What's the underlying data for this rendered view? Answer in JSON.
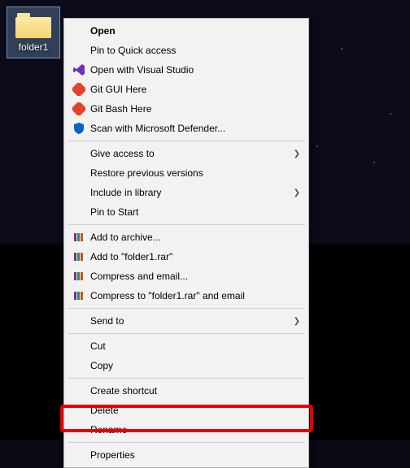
{
  "desktop": {
    "icon_label": "folder1"
  },
  "menu": {
    "open": "Open",
    "pin_quick_access": "Pin to Quick access",
    "open_vs": "Open with Visual Studio",
    "git_gui": "Git GUI Here",
    "git_bash": "Git Bash Here",
    "scan_defender": "Scan with Microsoft Defender...",
    "give_access": "Give access to",
    "restore_prev": "Restore previous versions",
    "include_library": "Include in library",
    "pin_start": "Pin to Start",
    "add_archive": "Add to archive...",
    "add_rar": "Add to \"folder1.rar\"",
    "compress_email": "Compress and email...",
    "compress_rar_email": "Compress to \"folder1.rar\" and email",
    "send_to": "Send to",
    "cut": "Cut",
    "copy": "Copy",
    "create_shortcut": "Create shortcut",
    "delete": "Delete",
    "rename": "Rename",
    "properties": "Properties"
  },
  "icons": {
    "vs": "visual-studio-icon",
    "git": "git-icon",
    "defender": "defender-shield-icon",
    "winrar": "winrar-books-icon"
  }
}
